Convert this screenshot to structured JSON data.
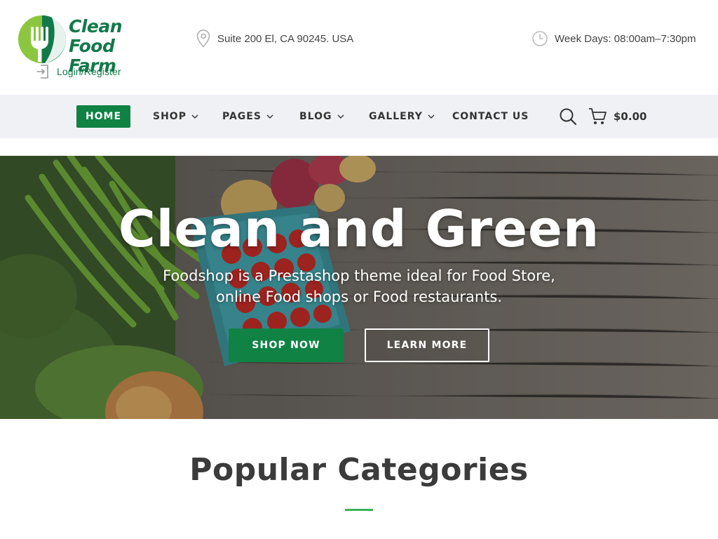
{
  "brand": {
    "name_line1": "Clean Food",
    "name_line2": "Farm",
    "logo_icon": "fork-leaf-logo-icon",
    "color_primary": "#0f8244",
    "color_logo_green": "#13794a",
    "color_light_green": "#8cc63f"
  },
  "header": {
    "login_label": "Login/Register",
    "login_icon": "login-door-icon",
    "address": "Suite 200 El, CA 90245. USA",
    "address_icon": "map-pin-icon",
    "hours": "Week Days: 08:00am–7:30pm",
    "hours_icon": "clock-icon"
  },
  "nav": {
    "items": [
      {
        "label": "HOME",
        "active": true,
        "has_dropdown": false
      },
      {
        "label": "SHOP",
        "active": false,
        "has_dropdown": true
      },
      {
        "label": "PAGES",
        "active": false,
        "has_dropdown": true
      },
      {
        "label": "BLOG",
        "active": false,
        "has_dropdown": true
      },
      {
        "label": "GALLERY",
        "active": false,
        "has_dropdown": true
      },
      {
        "label": "CONTACT US",
        "active": false,
        "has_dropdown": false
      }
    ],
    "search_icon": "search-icon",
    "cart_icon": "cart-icon",
    "cart_total": "$0.00",
    "bar_color": "#eff1f5"
  },
  "hero": {
    "title": "Clean and Green",
    "subtitle_line1": "Foodshop is a Prestashop theme ideal for Food Store,",
    "subtitle_line2": "online Food shops or Food restaurants.",
    "primary_button": "SHOP NOW",
    "secondary_button": "LEARN MORE"
  },
  "categories": {
    "title": "Popular Categories",
    "accent_color": "#3bb05b"
  }
}
